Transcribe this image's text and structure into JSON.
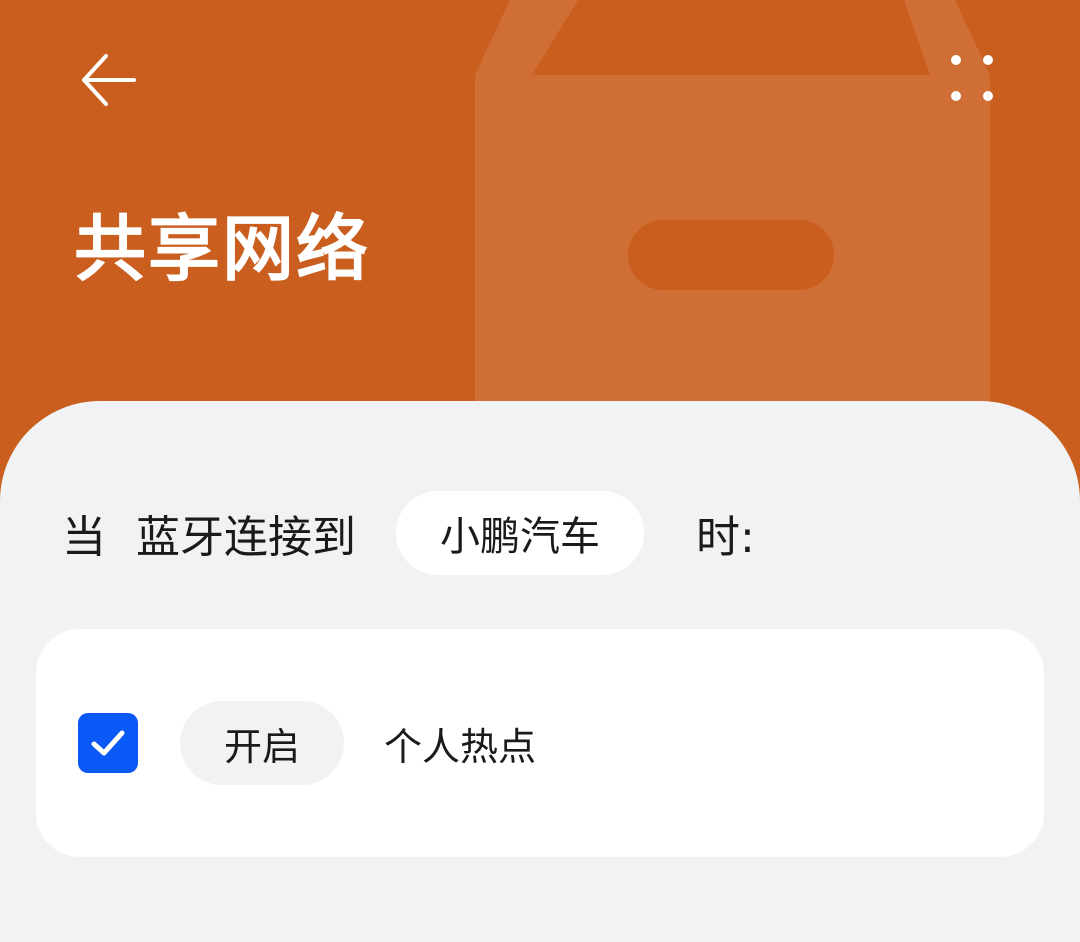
{
  "header": {
    "title": "共享网络",
    "back_icon": "arrow-left-icon",
    "more_icon": "more-dots-icon",
    "background_color": "#c95e1e",
    "decoration_icon": "briefcase-icon"
  },
  "condition": {
    "when_label": "当",
    "trigger_label": "蓝牙连接到",
    "device_name": "小鹏汽车",
    "suffix_label": "时:"
  },
  "action": {
    "checked": true,
    "check_icon": "checkmark-icon",
    "verb_label": "开启",
    "target_label": "个人热点",
    "accent_color": "#0a59f7"
  }
}
